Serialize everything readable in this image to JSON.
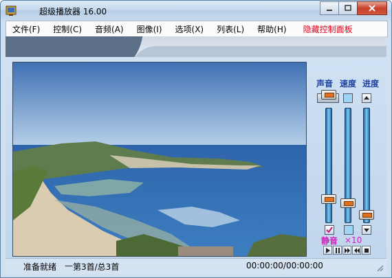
{
  "window": {
    "title": "超级播放器 16.00",
    "minimize_icon": "minimize-icon",
    "maximize_icon": "maximize-icon",
    "close_icon": "close-icon"
  },
  "menu": [
    {
      "label": "文件(F)"
    },
    {
      "label": "控制(C)"
    },
    {
      "label": "音频(A)"
    },
    {
      "label": "图像(I)"
    },
    {
      "label": "选项(X)"
    },
    {
      "label": "列表(L)"
    },
    {
      "label": "帮助(H)"
    }
  ],
  "hide_panel": "隐藏控制面板",
  "controls": {
    "volume_label": "声音",
    "speed_label": "速度",
    "progress_label": "进度",
    "mute_label": "静音",
    "speed_value": "×10",
    "mute_checked": true,
    "volume_level": 0.18,
    "speed_level": 0.14,
    "progress_level": 0.03
  },
  "status": {
    "ready": "准备就绪",
    "track": "第3首/总3首",
    "time": "00:00:00/00:00:00"
  },
  "colors": {
    "accent": "#1d3fa3",
    "mute": "#d41fbf",
    "menu_red": "#e0001b"
  }
}
